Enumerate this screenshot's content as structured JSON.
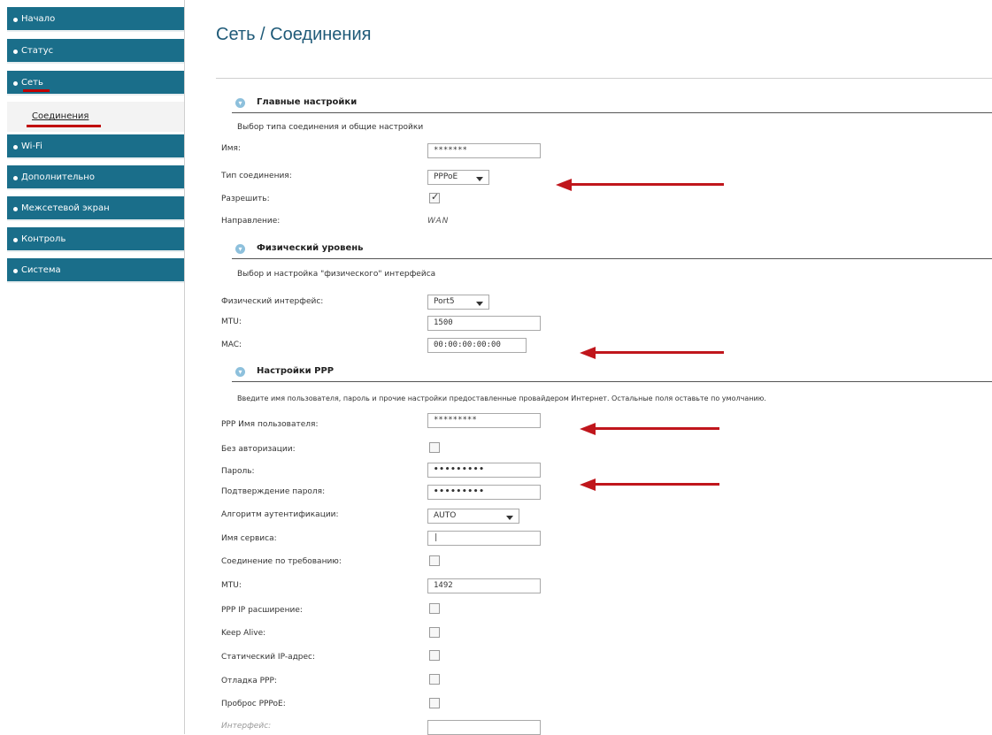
{
  "sidebar": {
    "items": [
      {
        "label": "Начало"
      },
      {
        "label": "Статус"
      },
      {
        "label": "Сеть"
      },
      {
        "label": "Wi-Fi"
      },
      {
        "label": "Дополнительно"
      },
      {
        "label": "Межсетевой экран"
      },
      {
        "label": "Контроль"
      },
      {
        "label": "Система"
      }
    ],
    "sub_item": {
      "label": "Соединения"
    }
  },
  "page": {
    "title": "Сеть / Соединения"
  },
  "sections": {
    "main": {
      "title": "Главные настройки",
      "description": "Выбор типа соединения и общие настройки",
      "name_label": "Имя:",
      "name_value": "*******",
      "type_label": "Тип соединения:",
      "type_value": "PPPoE",
      "enable_label": "Разрешить:",
      "direction_label": "Направление:",
      "direction_value": "WAN"
    },
    "physical": {
      "title": "Физический уровень",
      "description": "Выбор и настройка \"физического\" интерфейса",
      "iface_label": "Физический интерфейс:",
      "iface_value": "Port5",
      "mtu_label": "MTU:",
      "mtu_value": "1500",
      "mac_label": "MAC:",
      "mac_value": "00:00:00:00:00"
    },
    "ppp": {
      "title": "Настройки PPP",
      "description": "Введите имя пользователя, пароль и прочие настройки предоставленные провайдером Интернет. Остальные поля оставьте по умолчанию.",
      "username_label": "PPP Имя пользователя:",
      "username_value": "*********",
      "noauth_label": "Без авторизации:",
      "password_label": "Пароль:",
      "password_value": "•••••••••",
      "confirm_label": "Подтверждение пароля:",
      "confirm_value": "•••••••••",
      "auth_label": "Алгоритм аутентификации:",
      "auth_value": "AUTO",
      "service_label": "Имя сервиса:",
      "service_value": "|",
      "ondemand_label": "Соединение по требованию:",
      "mtu_label": "MTU:",
      "mtu_value": "1492",
      "ipext_label": "PPP IP расширение:",
      "keepalive_label": "Keep Alive:",
      "staticip_label": "Статический IP-адрес:",
      "debug_label": "Отладка PPP:",
      "passthrough_label": "Проброс PPPoE:",
      "interface_label": "Интерфейс:"
    }
  },
  "colors": {
    "nav_bg": "#1a6e8a",
    "arrow": "#c0161c",
    "title": "#1f5a78"
  }
}
